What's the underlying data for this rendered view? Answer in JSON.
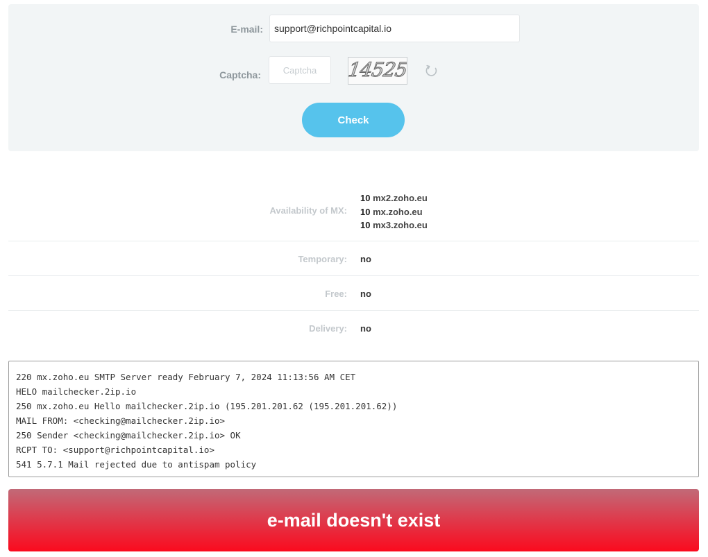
{
  "form": {
    "email_label": "E-mail:",
    "email_value": "support@richpointcapital.io",
    "captcha_label": "Captcha:",
    "captcha_placeholder": "Captcha",
    "captcha_code": "14525",
    "refresh_icon": "refresh-icon",
    "check_label": "Check",
    "accent_color": "#56c3ec"
  },
  "results": {
    "mx_label": "Availability of MX:",
    "mx_records": [
      {
        "priority": "10",
        "host": "mx2.zoho.eu"
      },
      {
        "priority": "10",
        "host": "mx.zoho.eu"
      },
      {
        "priority": "10",
        "host": "mx3.zoho.eu"
      }
    ],
    "temporary_label": "Temporary:",
    "temporary_value": "no",
    "free_label": "Free:",
    "free_value": "no",
    "delivery_label": "Delivery:",
    "delivery_value": "no"
  },
  "log": [
    "220 mx.zoho.eu SMTP Server ready February 7, 2024 11:13:56 AM CET",
    "HELO mailchecker.2ip.io",
    "250 mx.zoho.eu Hello mailchecker.2ip.io (195.201.201.62 (195.201.201.62))",
    "MAIL FROM: <checking@mailchecker.2ip.io>",
    "250 Sender <checking@mailchecker.2ip.io> OK",
    "RCPT TO: <support@richpointcapital.io>",
    "541 5.7.1 Mail rejected due to antispam policy"
  ],
  "verdict": {
    "text": "e-mail doesn't exist",
    "color": "#fb0a1e"
  }
}
